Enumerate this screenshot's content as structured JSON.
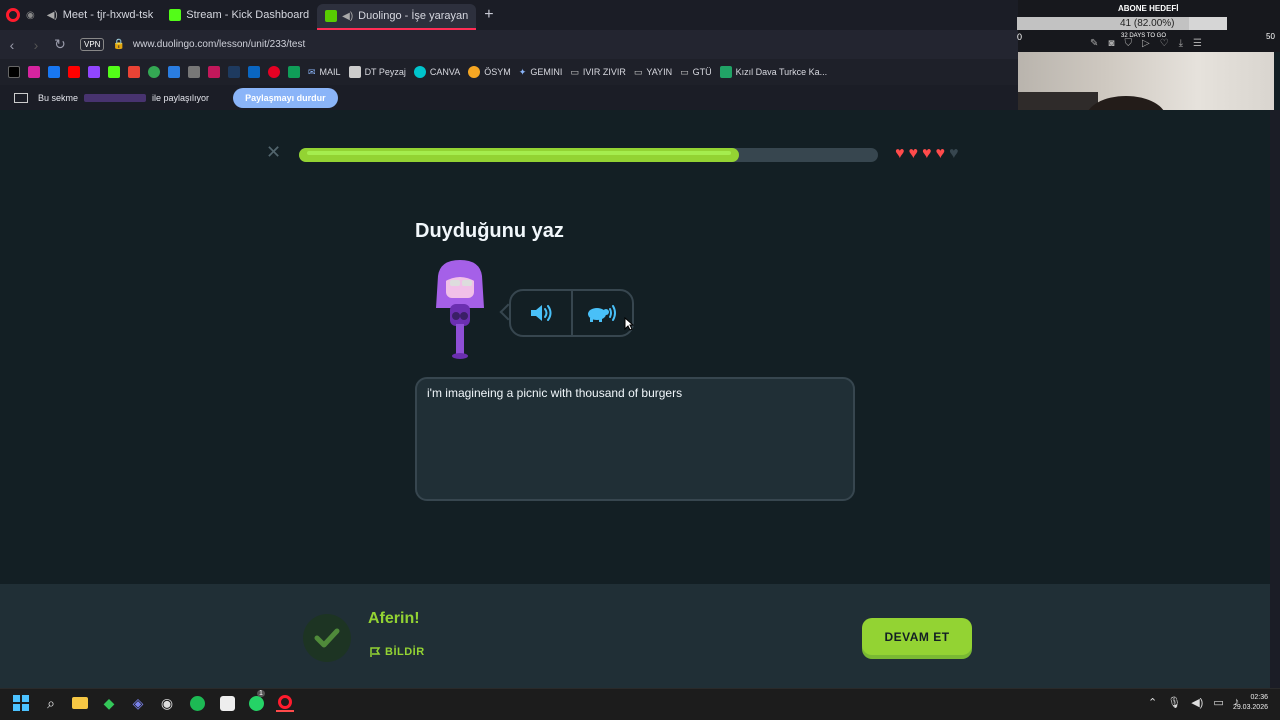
{
  "browser": {
    "tabs": [
      {
        "label": "Meet - tjr-hxwd-tsk",
        "active": false
      },
      {
        "label": "Stream - Kick Dashboard",
        "active": false
      },
      {
        "label": "Duolingo - İşe yarayan",
        "active": true
      }
    ],
    "new_tab_glyph": "+",
    "url": "www.duolingo.com/lesson/unit/233/test",
    "vpn_label": "VPN",
    "bookmarks": [
      {
        "label": "MAIL"
      },
      {
        "label": "DT Peyzaj"
      },
      {
        "label": "CANVA"
      },
      {
        "label": "ÖSYM"
      },
      {
        "label": "GEMINI"
      },
      {
        "label": "IVIR ZIVIR"
      },
      {
        "label": "YAYIN"
      },
      {
        "label": "GTÜ"
      },
      {
        "label": "Kızıl Dava Turkce Ka..."
      }
    ],
    "share_bar": {
      "prefix": "Bu sekme",
      "suffix": "ile paylaşılıyor",
      "stop_button": "Paylaşmayı durdur"
    }
  },
  "stream_overlay": {
    "goal_title": "ABONE HEDEFİ",
    "goal_text": "41 (82.00%)",
    "goal_progress": 0.82,
    "goal_start": "0",
    "goal_end": "50",
    "days_left": "32 DAYS TO GO"
  },
  "lesson": {
    "progress": 0.76,
    "hearts": {
      "full": 4,
      "empty": 1
    },
    "title": "Duyduğunu yaz",
    "answer_text": "i'm imagineing a picnic with thousand of burgers"
  },
  "feedback": {
    "message": "Aferin!",
    "report_label": "BİLDİR",
    "continue_label": "DEVAM ET"
  },
  "system": {
    "time": "02:36",
    "date": "29.03.2026",
    "whatsapp_badge": "1"
  },
  "colors": {
    "background": "#131f24",
    "footer": "#202f36",
    "accent_green": "#93d333",
    "heart_red": "#ff4b4b",
    "border": "#37464f"
  }
}
